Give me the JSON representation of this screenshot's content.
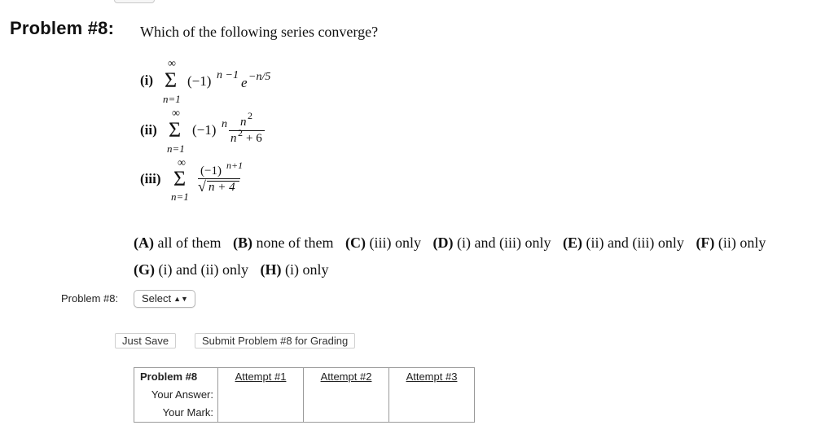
{
  "problem": {
    "title": "Problem #8:",
    "question": "Which of the following series converge?"
  },
  "series": {
    "i": {
      "label": "(i)",
      "upper": "∞",
      "lower": "n=1",
      "sign": "(−1)",
      "sign_exp": "n −1",
      "base": "e",
      "base_exp": "−n/5"
    },
    "ii": {
      "label": "(ii)",
      "upper": "∞",
      "lower": "n=1",
      "sign": "(−1)",
      "sign_exp": "n",
      "numerator": "n",
      "numerator_exp": "2",
      "denominator": "n",
      "denominator_exp": "2",
      "denominator_tail": "+ 6"
    },
    "iii": {
      "label": "(iii)",
      "upper": "∞",
      "lower": "n=1",
      "numerator": "(−1)",
      "numerator_exp": "n+1",
      "radical": "√",
      "denominator": "n + 4"
    }
  },
  "choices": [
    {
      "key": "(A)",
      "text": "all of them"
    },
    {
      "key": "(B)",
      "text": "none of them"
    },
    {
      "key": "(C)",
      "text": "(iii) only"
    },
    {
      "key": "(D)",
      "text": "(i) and (iii) only"
    },
    {
      "key": "(E)",
      "text": "(ii) and (iii) only"
    },
    {
      "key": "(F)",
      "text": "(ii) only"
    },
    {
      "key": "(G)",
      "text": "(i) and (ii) only"
    },
    {
      "key": "(H)",
      "text": "(i) only"
    }
  ],
  "answer": {
    "label": "Problem #8:",
    "select_value": "Select",
    "select_arrows": "▲▼"
  },
  "buttons": {
    "just_save": "Just Save",
    "submit": "Submit Problem #8 for Grading"
  },
  "attempts_table": {
    "header": "Problem #8",
    "row_your_answer": "Your Answer:",
    "row_your_mark": "Your Mark:",
    "attempts": [
      "Attempt #1",
      "Attempt #2",
      "Attempt #3"
    ]
  }
}
